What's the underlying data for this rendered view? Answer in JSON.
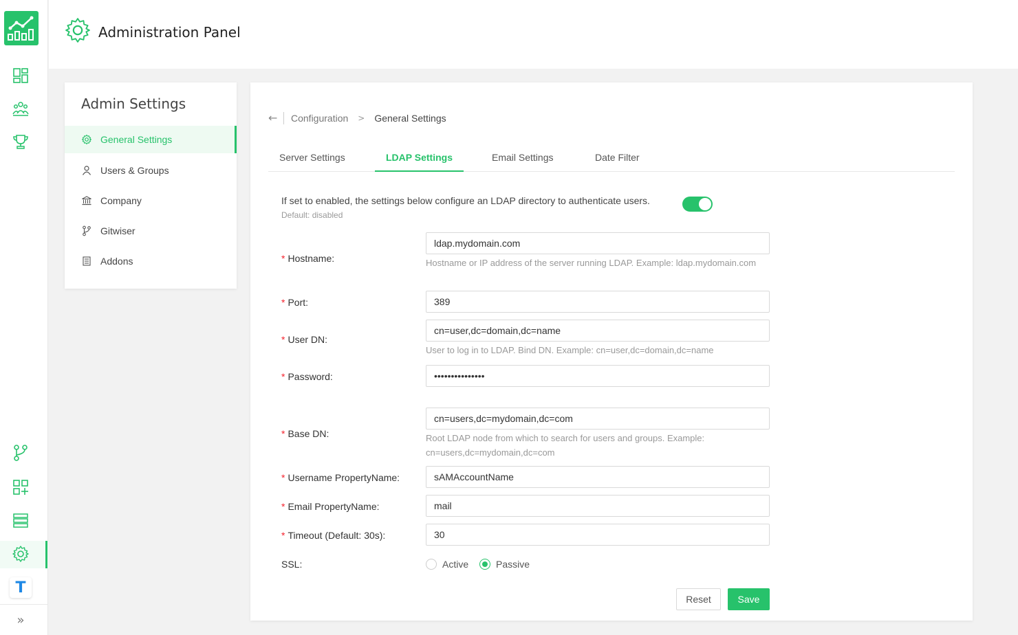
{
  "header": {
    "title": "Administration Panel"
  },
  "admin_menu": {
    "heading": "Admin Settings",
    "items": [
      {
        "label": "General Settings",
        "icon": "gear-icon",
        "active": true
      },
      {
        "label": "Users & Groups",
        "icon": "user-icon",
        "active": false
      },
      {
        "label": "Company",
        "icon": "bank-icon",
        "active": false
      },
      {
        "label": "Gitwiser",
        "icon": "branch-icon",
        "active": false
      },
      {
        "label": "Addons",
        "icon": "list-icon",
        "active": false
      }
    ]
  },
  "breadcrumb": {
    "parent": "Configuration",
    "separator": ">",
    "current": "General Settings"
  },
  "tabs": [
    "Server Settings",
    "LDAP Settings",
    "Email Settings",
    "Date Filter"
  ],
  "active_tab": "LDAP Settings",
  "ldap": {
    "intro": "If set to enabled, the settings below configure an LDAP directory to authenticate users.",
    "intro_default": "Default: disabled",
    "enabled": true,
    "fields": {
      "hostname": {
        "label": "Hostname:",
        "value": "ldap.mydomain.com",
        "hint": "Hostname or IP address of the server running LDAP. Example: ldap.mydomain.com"
      },
      "port": {
        "label": "Port:",
        "value": "389"
      },
      "user_dn": {
        "label": "User DN:",
        "value": "cn=user,dc=domain,dc=name",
        "hint": "User to log in to LDAP. Bind DN. Example: cn=user,dc=domain,dc=name"
      },
      "password": {
        "label": "Password:",
        "value": "•••••••••••••••"
      },
      "base_dn": {
        "label": "Base DN:",
        "value": "cn=users,dc=mydomain,dc=com",
        "hint": "Root LDAP node from which to search for users and groups. Example: cn=users,dc=mydomain,dc=com"
      },
      "username_property": {
        "label": "Username PropertyName:",
        "value": "sAMAccountName"
      },
      "email_property": {
        "label": "Email PropertyName:",
        "value": "mail"
      },
      "timeout": {
        "label": "Timeout (Default: 30s):",
        "value": "30"
      }
    },
    "ssl": {
      "label": "SSL:",
      "options": [
        "Active",
        "Passive"
      ],
      "selected": "Passive"
    },
    "required_mark": "*"
  },
  "actions": {
    "reset": "Reset",
    "save": "Save"
  },
  "colors": {
    "accent": "#27c26b",
    "required": "#f5222d"
  }
}
